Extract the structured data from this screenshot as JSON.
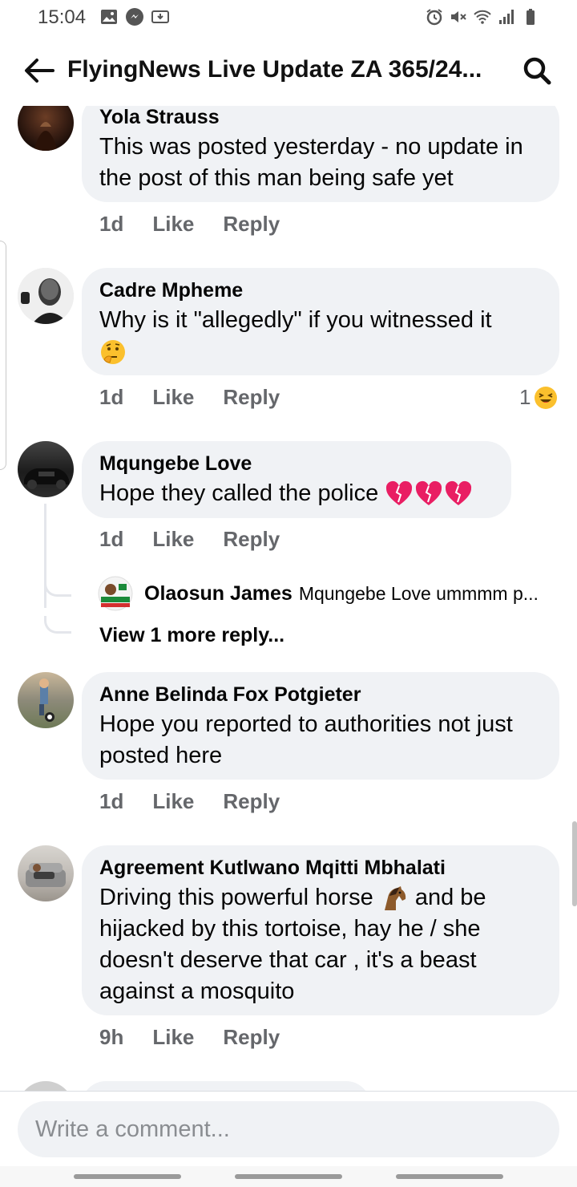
{
  "status_bar": {
    "time": "15:04",
    "left_icons": [
      "gallery-icon",
      "messenger-icon",
      "download-icon"
    ],
    "right_icons": [
      "alarm-icon",
      "mute-icon",
      "wifi-icon",
      "signal-icon",
      "battery-icon"
    ]
  },
  "header": {
    "title": "FlyingNews Live Update ZA 365/24...",
    "back_icon": "arrow-left-icon",
    "search_icon": "search-icon"
  },
  "comments": [
    {
      "author": "Yola Strauss",
      "text": "This was posted yesterday - no update in the post of this man being safe yet",
      "time": "1d",
      "like": "Like",
      "reply": "Reply"
    },
    {
      "author": "Cadre Mpheme",
      "text": "Why is it \"allegedly\" if you witnessed it",
      "emoji": "thinking-face-emoji",
      "time": "1d",
      "like": "Like",
      "reply": "Reply",
      "reaction_count": "1",
      "reaction": "laughing-emoji"
    },
    {
      "author": "Mqungebe Love",
      "text": "Hope they called the police",
      "emoji": "broken-heart-emoji",
      "time": "1d",
      "like": "Like",
      "reply": "Reply",
      "replies": [
        {
          "author": "Olaosun James",
          "snippet": "Mqungebe Love ummmm p..."
        }
      ],
      "view_more": "View 1 more reply..."
    },
    {
      "author": "Anne Belinda Fox Potgieter",
      "text": "Hope you reported to authorities not just posted here",
      "time": "1d",
      "like": "Like",
      "reply": "Reply"
    },
    {
      "author": "Agreement Kutlwano Mqitti Mbhalati",
      "text_before": "Driving this powerful horse",
      "emoji": "horse-emoji",
      "text_after": "and be hijacked by this tortoise,  hay he / she doesn't deserve that car , it's a beast against a mosquito",
      "time": "9h",
      "like": "Like",
      "reply": "Reply"
    }
  ],
  "composer": {
    "placeholder": "Write a comment..."
  },
  "colors": {
    "bubble": "#f0f2f5",
    "meta_text": "#65676b",
    "thread_line": "#e4e6eb"
  }
}
